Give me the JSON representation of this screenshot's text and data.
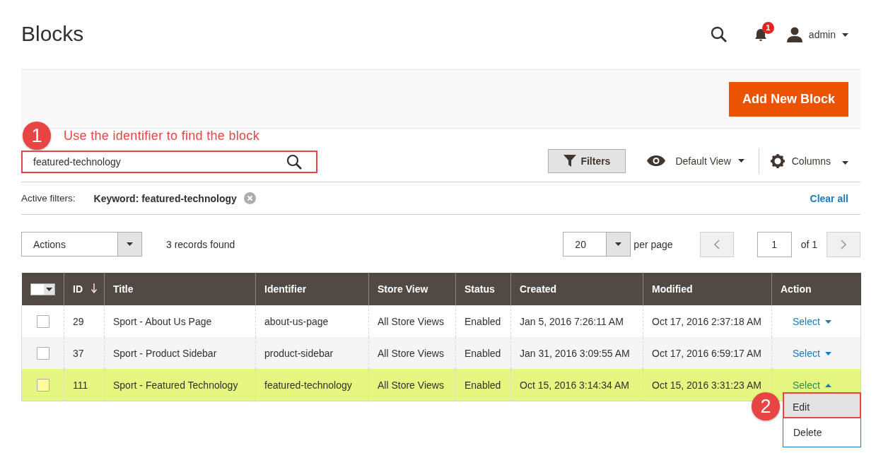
{
  "header": {
    "title": "Blocks",
    "notification_count": "1",
    "user": "admin"
  },
  "page_actions": {
    "add_button": "Add New Block"
  },
  "annotations": [
    {
      "number": "1",
      "text": "Use the identifier to find the block"
    },
    {
      "number": "2"
    }
  ],
  "search": {
    "value": "featured-technology"
  },
  "toolbar": {
    "filters": "Filters",
    "view": "Default View",
    "columns": "Columns"
  },
  "active_filters": {
    "label": "Active filters:",
    "chips": [
      "Keyword: featured-technology"
    ],
    "clear": "Clear all"
  },
  "mass_actions": {
    "label": "Actions"
  },
  "records": "3 records found",
  "per_page": {
    "value": "20",
    "label": "per page"
  },
  "pagination": {
    "page": "1",
    "of": "of 1"
  },
  "table": {
    "select_all": {
      "checked": false
    },
    "columns": [
      {
        "label": "ID",
        "sorted": true
      },
      {
        "label": "Title",
        "sorted": false
      },
      {
        "label": "Identifier",
        "sorted": false
      },
      {
        "label": "Store View",
        "sorted": false
      },
      {
        "label": "Status",
        "sorted": false
      },
      {
        "label": "Created",
        "sorted": false
      },
      {
        "label": "Modified",
        "sorted": false
      },
      {
        "label": "Action",
        "sorted": false
      }
    ],
    "rows": [
      {
        "checked": false,
        "highlighted": false,
        "cells": [
          "29",
          "Sport - About Us Page",
          "about-us-page",
          "All Store Views",
          "Enabled",
          "Jan 5, 2016 7:26:11 AM",
          "Oct 17, 2016 2:37:18 AM"
        ],
        "action": "Select",
        "expanded": false
      },
      {
        "checked": false,
        "highlighted": false,
        "cells": [
          "37",
          "Sport - Product Sidebar",
          "product-sidebar",
          "All Store Views",
          "Enabled",
          "Jan 31, 2016 3:09:55 AM",
          "Oct 17, 2016 6:59:17 AM"
        ],
        "action": "Select",
        "expanded": false
      },
      {
        "checked": false,
        "highlighted": true,
        "cells": [
          "111",
          "Sport - Featured Technology",
          "featured-technology",
          "All Store Views",
          "Enabled",
          "Oct 15, 2016 3:14:34 AM",
          "Oct 15, 2016 3:31:23 AM"
        ],
        "action": "Select",
        "expanded": true,
        "menu": [
          {
            "label": "Edit",
            "highlighted": true
          },
          {
            "label": "Delete",
            "highlighted": false
          }
        ]
      }
    ]
  }
}
